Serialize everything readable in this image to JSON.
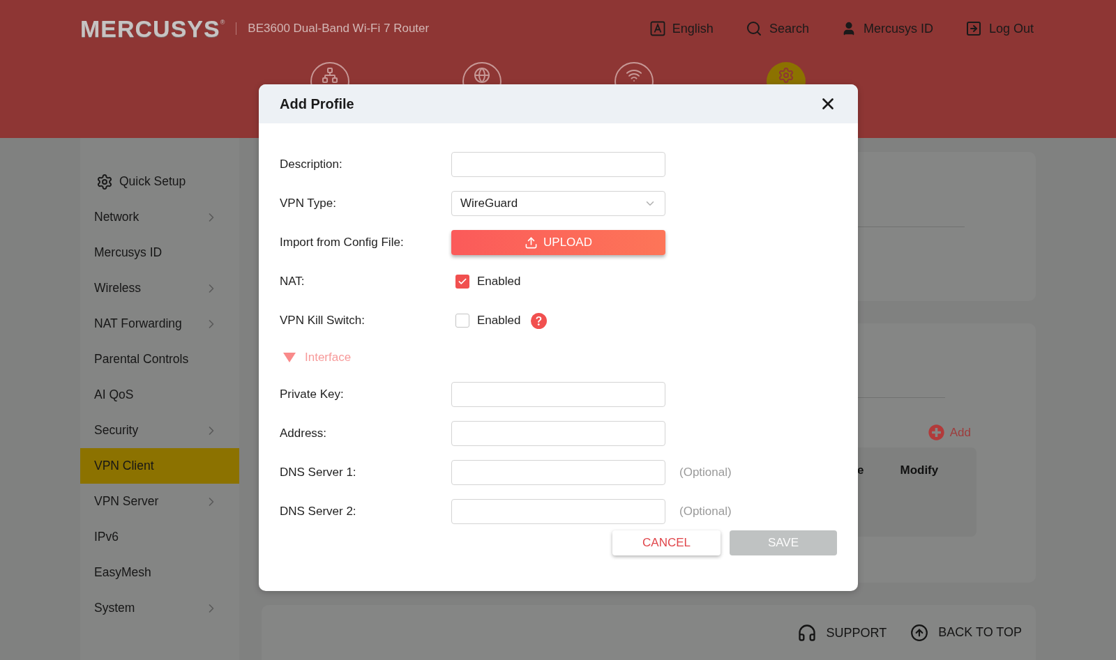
{
  "header": {
    "logo": "MERCUSYS",
    "logo_mark": "®",
    "product": "BE3600 Dual-Band Wi-Fi 7 Router",
    "actions": [
      {
        "kind": "language",
        "label": "English"
      },
      {
        "kind": "search",
        "label": "Search"
      },
      {
        "kind": "account",
        "label": "Mercusys ID"
      },
      {
        "kind": "logout",
        "label": "Log Out"
      }
    ],
    "nav_tabs": [
      {
        "kind": "network",
        "selected": false
      },
      {
        "kind": "internet",
        "selected": false
      },
      {
        "kind": "wireless",
        "selected": false
      },
      {
        "kind": "advanced",
        "selected": true
      }
    ]
  },
  "sidebar": {
    "items": [
      {
        "label": "Quick Setup",
        "kind": "quick_setup",
        "submenu": false,
        "selected": false
      },
      {
        "label": "Network",
        "kind": "item",
        "submenu": true,
        "selected": false
      },
      {
        "label": "Mercusys ID",
        "kind": "item",
        "submenu": false,
        "selected": false
      },
      {
        "label": "Wireless",
        "kind": "item",
        "submenu": true,
        "selected": false
      },
      {
        "label": "NAT Forwarding",
        "kind": "item",
        "submenu": true,
        "selected": false
      },
      {
        "label": "Parental Controls",
        "kind": "item",
        "submenu": false,
        "selected": false
      },
      {
        "label": "AI QoS",
        "kind": "item",
        "submenu": false,
        "selected": false
      },
      {
        "label": "Security",
        "kind": "item",
        "submenu": true,
        "selected": false
      },
      {
        "label": "VPN Client",
        "kind": "item",
        "submenu": false,
        "selected": true
      },
      {
        "label": "VPN Server",
        "kind": "item",
        "submenu": true,
        "selected": false
      },
      {
        "label": "IPv6",
        "kind": "item",
        "submenu": false,
        "selected": false
      },
      {
        "label": "EasyMesh",
        "kind": "item",
        "submenu": false,
        "selected": false
      },
      {
        "label": "System",
        "kind": "item",
        "submenu": true,
        "selected": false
      }
    ]
  },
  "content": {
    "add_button": "Add",
    "table": {
      "columns": [
        "e",
        "Modify"
      ]
    }
  },
  "footer": {
    "links": [
      {
        "kind": "support",
        "label": "SUPPORT"
      },
      {
        "kind": "top",
        "label": "BACK TO TOP"
      }
    ]
  },
  "dialog": {
    "title": "Add Profile",
    "fields": [
      {
        "kind": "text",
        "label": "Description:"
      },
      {
        "kind": "select",
        "label": "VPN Type:",
        "value": "WireGuard"
      },
      {
        "kind": "upload",
        "label": "Import from Config File:",
        "button": "UPLOAD"
      },
      {
        "kind": "checkbox",
        "label": "NAT:",
        "option": "Enabled",
        "checked": true,
        "help": false
      },
      {
        "kind": "checkbox",
        "label": "VPN Kill Switch:",
        "option": "Enabled",
        "checked": false,
        "help": true
      },
      {
        "kind": "section",
        "label": "Interface",
        "expanded": true
      },
      {
        "kind": "text",
        "label": "Private Key:"
      },
      {
        "kind": "text",
        "label": "Address:"
      },
      {
        "kind": "text",
        "label": "DNS Server 1:",
        "hint": "(Optional)"
      },
      {
        "kind": "text",
        "label": "DNS Server 2:",
        "hint": "(Optional)"
      }
    ],
    "cancel": {
      "label": "CANCEL",
      "disabled": false
    },
    "save": {
      "label": "SAVE",
      "disabled": true
    }
  }
}
